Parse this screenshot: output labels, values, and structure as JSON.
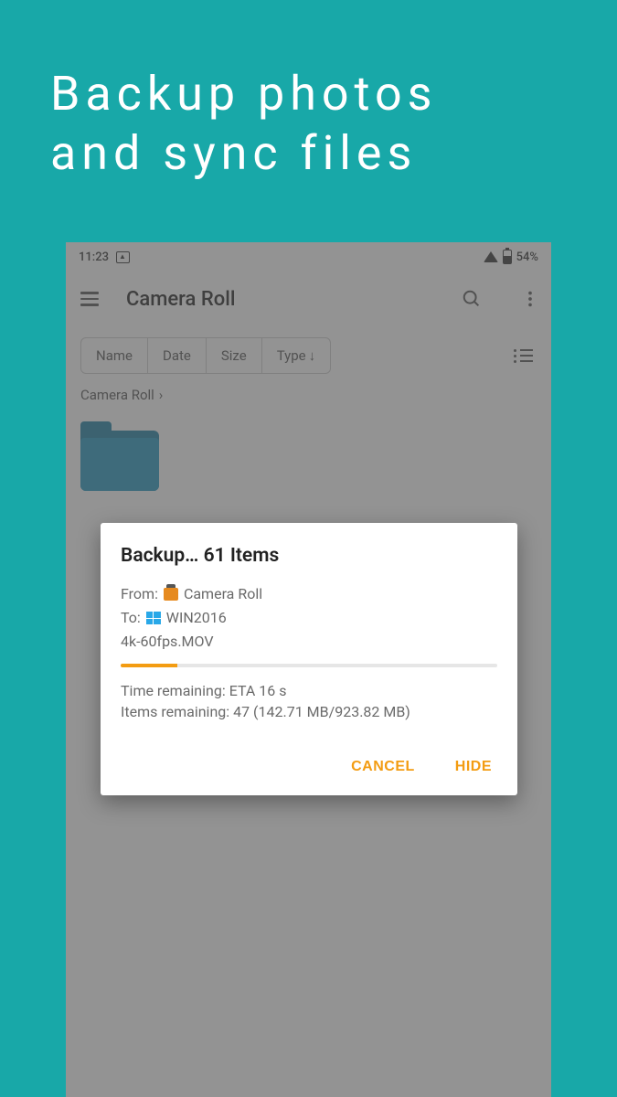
{
  "promo": {
    "line1": "Backup photos",
    "line2": "and sync files"
  },
  "status": {
    "time": "11:23",
    "battery_pct": "54%"
  },
  "appbar": {
    "title": "Camera Roll"
  },
  "sort": {
    "name": "Name",
    "date": "Date",
    "size": "Size",
    "type": "Type"
  },
  "breadcrumb": {
    "path": "Camera Roll"
  },
  "dialog": {
    "title": "Backup… 61 Items",
    "from_label": "From:",
    "from_value": "Camera Roll",
    "to_label": "To:",
    "to_value": "WIN2016",
    "current_file": "4k-60fps.MOV",
    "time_remaining": "Time remaining: ETA 16 s",
    "items_remaining": "Items remaining: 47 (142.71 MB/923.82 MB)",
    "cancel": "CANCEL",
    "hide": "HIDE",
    "progress_pct": 15
  }
}
